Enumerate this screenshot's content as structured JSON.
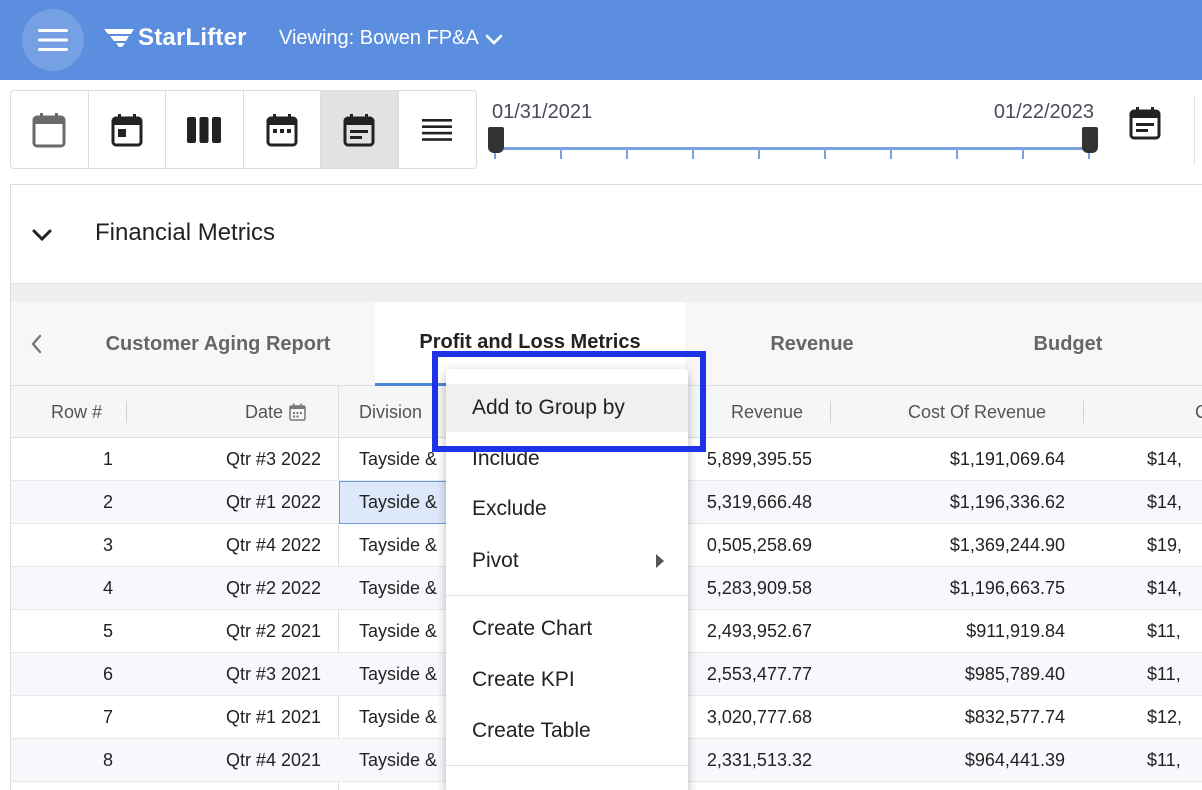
{
  "header": {
    "brand": "StarLifter",
    "viewing_label": "Viewing: Bowen FP&A",
    "background": "#5b8ede"
  },
  "toolbar": {
    "views": [
      "calendar-blank-icon",
      "calendar-today-icon",
      "view-column-icon",
      "calendar-month-icon",
      "calendar-text-icon",
      "view-headline-icon"
    ],
    "active_view": "calendar-text-icon"
  },
  "range": {
    "start": "01/31/2021",
    "end": "01/22/2023"
  },
  "section": {
    "title": "Financial Metrics"
  },
  "tabs": [
    {
      "label": "Customer Aging Report",
      "active": false
    },
    {
      "label": "Profit and Loss Metrics",
      "active": true
    },
    {
      "label": "Revenue",
      "active": false
    },
    {
      "label": "Budget",
      "active": false
    }
  ],
  "grid": {
    "headers": {
      "row": "Row #",
      "date": "Date",
      "division": "Division",
      "revenue": "Revenue",
      "cost_of_revenue": "Cost Of Revenue",
      "next_partial": "C"
    },
    "rows": [
      {
        "n": "1",
        "date": "Qtr #3 2022",
        "division": "Tayside &",
        "revenue": "5,899,395.55",
        "cost": "$1,191,069.64",
        "next": "$14,"
      },
      {
        "n": "2",
        "date": "Qtr #1 2022",
        "division": "Tayside &",
        "revenue": "5,319,666.48",
        "cost": "$1,196,336.62",
        "next": "$14,"
      },
      {
        "n": "3",
        "date": "Qtr #4 2022",
        "division": "Tayside &",
        "revenue": "0,505,258.69",
        "cost": "$1,369,244.90",
        "next": "$19,"
      },
      {
        "n": "4",
        "date": "Qtr #2 2022",
        "division": "Tayside &",
        "revenue": "5,283,909.58",
        "cost": "$1,196,663.75",
        "next": "$14,"
      },
      {
        "n": "5",
        "date": "Qtr #2 2021",
        "division": "Tayside &",
        "revenue": "2,493,952.67",
        "cost": "$911,919.84",
        "next": "$11,"
      },
      {
        "n": "6",
        "date": "Qtr #3 2021",
        "division": "Tayside &",
        "revenue": "2,553,477.77",
        "cost": "$985,789.40",
        "next": "$11,"
      },
      {
        "n": "7",
        "date": "Qtr #1 2021",
        "division": "Tayside &",
        "revenue": "3,020,777.68",
        "cost": "$832,577.74",
        "next": "$12,"
      },
      {
        "n": "8",
        "date": "Qtr #4 2021",
        "division": "Tayside &",
        "revenue": "2,331,513.32",
        "cost": "$964,441.39",
        "next": "$11,"
      }
    ]
  },
  "context_menu": {
    "items": {
      "group_by": "Add to Group by",
      "include": "Include",
      "exclude": "Exclude",
      "pivot": "Pivot",
      "create_chart": "Create Chart",
      "create_kpi": "Create KPI",
      "create_table": "Create Table"
    },
    "highlight_color": "#1f33e6"
  }
}
